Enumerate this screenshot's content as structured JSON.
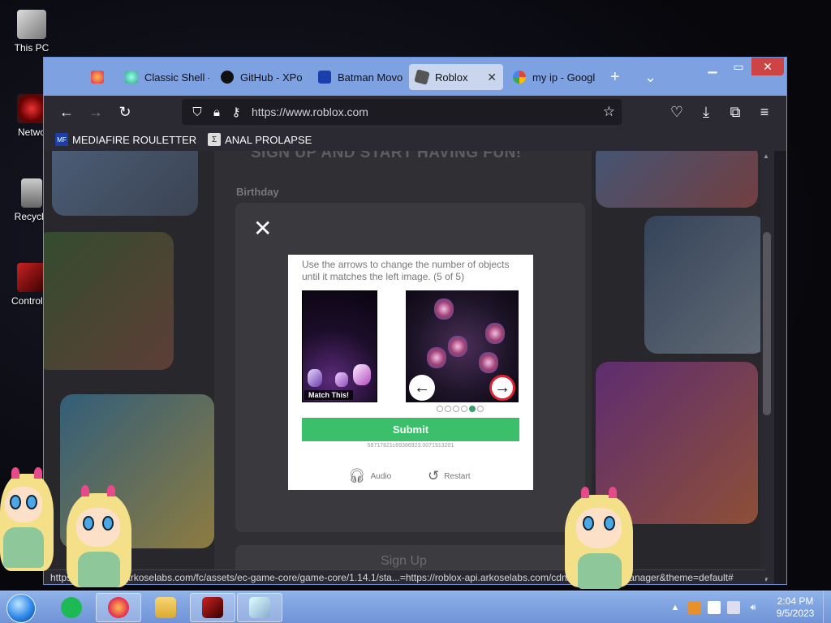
{
  "desktop": {
    "icons": [
      {
        "label": "This PC"
      },
      {
        "label": "Netwo"
      },
      {
        "label": "Recycle"
      },
      {
        "label": "Control P"
      }
    ]
  },
  "browser": {
    "tabs": [
      {
        "label": "",
        "icon": "firefox-view-icon"
      },
      {
        "label": "Classic Shell -",
        "icon": "classic-shell-icon"
      },
      {
        "label": "GitHub - XPo",
        "icon": "github-icon"
      },
      {
        "label": "Batman Movo",
        "icon": "mediafire-icon"
      },
      {
        "label": "Roblox",
        "icon": "roblox-icon",
        "active": true
      },
      {
        "label": "my ip - Googl",
        "icon": "google-icon"
      }
    ],
    "tab_close": "✕",
    "new_tab": "+",
    "list_tabs": "⌄",
    "window_controls": {
      "minimize": "▁",
      "maximize": "▭",
      "close": "✕"
    },
    "nav": {
      "back": "←",
      "forward": "→",
      "reload": "↻"
    },
    "url": "https://www.roblox.com",
    "bookmark_star": "☆",
    "toolbar_icons": {
      "pocket": "♡",
      "downloads": "⤓",
      "extensions": "⧉",
      "menu": "≡"
    },
    "bookmarks": [
      {
        "label": "MEDIAFIRE ROULETTER",
        "icon": "MF"
      },
      {
        "label": "ANAL PROLAPSE",
        "icon": "Σ"
      }
    ],
    "status_url": "https://roblox-api.arkoselabs.com/fc/assets/ec-game-core/game-core/1.14.1/sta...=https://roblox-api.arkoselabs.com/cdn/fc/js/...style-manager&theme=default#"
  },
  "page": {
    "heading": "SIGN UP AND START HAVING FUN!",
    "birthday_label": "Birthday",
    "close_symbol": "✕",
    "signup_button": "Sign Up"
  },
  "captcha": {
    "instruction": "Use the arrows to change the number of objects until it matches the left image. (5 of 5)",
    "match_label": "Match This!",
    "left_arrow": "←",
    "right_arrow": "→",
    "progress": {
      "current": 5,
      "total": 6
    },
    "submit_label": "Submit",
    "session_id": "58717821c89386923.0071913201",
    "audio_label": "Audio",
    "restart_label": "Restart"
  },
  "taskbar": {
    "clock_time": "2:04 PM",
    "clock_date": "9/5/2023",
    "tray_expand": "▲"
  },
  "colors": {
    "titlebar": "#7ea1e2",
    "submit": "#3cbf6a",
    "taskbar": "#7fa3e0"
  }
}
